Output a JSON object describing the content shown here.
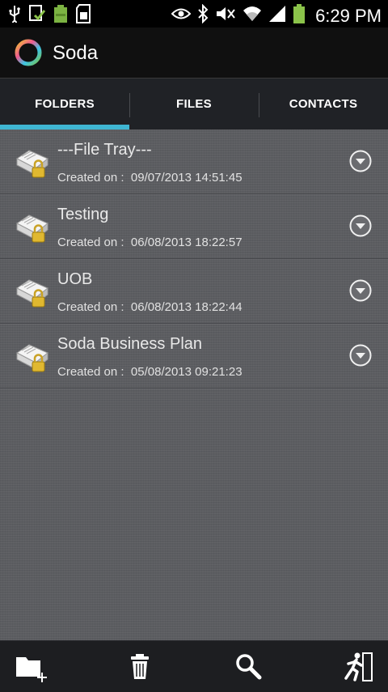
{
  "status_bar": {
    "time": "6:29 PM",
    "icons": [
      "usb-icon",
      "download-done-icon",
      "battery-app-icon",
      "sd-card-icon",
      "eye-icon",
      "bluetooth-icon",
      "mute-icon",
      "wifi-icon",
      "signal-icon",
      "battery-icon"
    ]
  },
  "app": {
    "title": "Soda",
    "logo": "soda-logo-icon"
  },
  "tabs": [
    {
      "label": "FOLDERS",
      "active": true
    },
    {
      "label": "FILES",
      "active": false
    },
    {
      "label": "CONTACTS",
      "active": false
    }
  ],
  "folders": [
    {
      "name": "---File Tray---",
      "created_label": "Created on :",
      "created_value": "09/07/2013 14:51:45"
    },
    {
      "name": "Testing",
      "created_label": "Created on :",
      "created_value": "06/08/2013 18:22:57"
    },
    {
      "name": "UOB",
      "created_label": "Created on :",
      "created_value": "06/08/2013 18:22:44"
    },
    {
      "name": "Soda Business Plan",
      "created_label": "Created on :",
      "created_value": "05/08/2013 09:21:23"
    }
  ],
  "bottom_bar": {
    "items": [
      "add-folder-icon",
      "delete-icon",
      "search-icon",
      "exit-icon"
    ]
  },
  "colors": {
    "accent": "#3fb6d2",
    "background": "#5c5d61",
    "actionbar": "#101010",
    "tabs": "#202226",
    "bottombar": "#1d1e21"
  }
}
